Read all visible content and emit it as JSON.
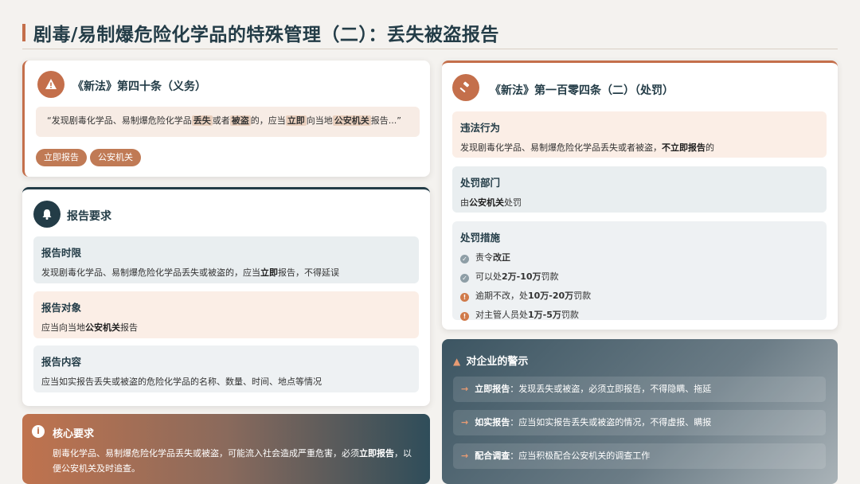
{
  "page": {
    "title": "剧毒/易制爆危险化学品的特殊管理（二）：丢失被盗报告"
  },
  "duty": {
    "icon": "warning-icon",
    "heading": "《新法》第四十条（义务）",
    "quote_parts": [
      "“发现剧毒化学品、易制爆危险化学品",
      "丢失",
      "或者",
      "被盗",
      "的，应当",
      "立即",
      "向当地",
      "公安机关",
      "报告...”"
    ],
    "tags": [
      "立即报告",
      "公安机关"
    ]
  },
  "report": {
    "icon": "bell-icon",
    "heading": "报告要求",
    "items": [
      {
        "title": "报告时限",
        "pre": "发现剧毒化学品、易制爆危险化学品丢失或被盗的，应当",
        "bold": "立即",
        "post": "报告，不得延误"
      },
      {
        "title": "报告对象",
        "pre": "应当向当地",
        "bold": "公安机关",
        "post": "报告"
      },
      {
        "title": "报告内容",
        "pre": "应当如实报告丢失或被盗的危险化学品的名称、数量、时间、地点等情况",
        "bold": "",
        "post": ""
      }
    ]
  },
  "core": {
    "icon": "info-icon",
    "heading": "核心要求",
    "line1_pre": "剧毒化学品、易制爆危险化学品丢失或被盗，可能流入社会造成严重危害，必须",
    "line1_bold": "立即报告",
    "line1_post": "，以",
    "line2": "便公安机关及时追查。"
  },
  "penalty": {
    "icon": "gavel-icon",
    "heading": "《新法》第一百零四条（二）（处罚）",
    "violation": {
      "title": "违法行为",
      "pre": "发现剧毒化学品、易制爆危险化学品丢失或者被盗，",
      "bold": "不立即报告",
      "post": "的"
    },
    "department": {
      "title": "处罚部门",
      "pre": "由",
      "bold": "公安机关",
      "post": "处罚"
    },
    "measures": {
      "title": "处罚措施",
      "items": [
        {
          "pre": "责令",
          "bold": "改正",
          "post": "",
          "level": "check"
        },
        {
          "pre": "可以处",
          "bold": "2万-10万",
          "post": "罚款",
          "level": "check"
        },
        {
          "pre": "逾期不改，处",
          "bold": "10万-20万",
          "post": "罚款",
          "level": "alert"
        },
        {
          "pre": "对主管人员处",
          "bold": "1万-5万",
          "post": "罚款",
          "level": "alert"
        }
      ]
    }
  },
  "warning": {
    "icon": "warning-icon",
    "heading": "对企业的警示",
    "items": [
      {
        "bold": "立即报告",
        "text": "：发现丢失或被盗，必须立即报告，不得隐瞒、拖延"
      },
      {
        "bold": "如实报告",
        "text": "：应当如实报告丢失或被盗的情况，不得虚报、瞒报"
      },
      {
        "bold": "配合调查",
        "text": "：应当积极配合公安机关的调查工作"
      }
    ]
  },
  "colors": {
    "accent": "#c46f4b",
    "navy": "#233c47"
  }
}
